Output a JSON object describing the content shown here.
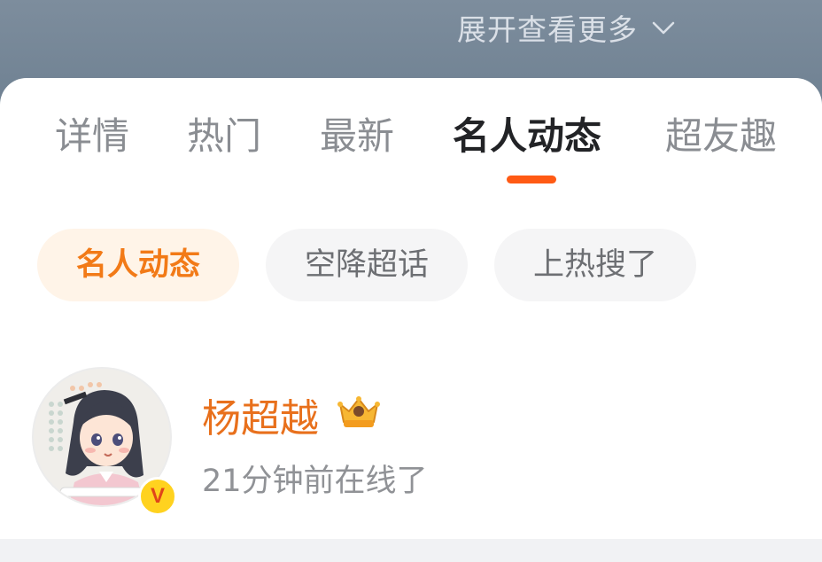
{
  "header": {
    "expand_label": "展开查看更多"
  },
  "tabs": [
    {
      "label": "详情",
      "active": false
    },
    {
      "label": "热门",
      "active": false
    },
    {
      "label": "最新",
      "active": false
    },
    {
      "label": "名人动态",
      "active": true
    },
    {
      "label": "超友趣",
      "active": false
    }
  ],
  "chips": [
    {
      "label": "名人动态",
      "active": true
    },
    {
      "label": "空降超话",
      "active": false
    },
    {
      "label": "上热搜了",
      "active": false
    }
  ],
  "user": {
    "name": "杨超越",
    "status": "21分钟前在线了",
    "verified_mark": "V"
  },
  "colors": {
    "accent": "#ff5a14",
    "name": "#e8701c",
    "chip_active_bg": "#fff4e8",
    "chip_active_text": "#f27a17",
    "header_bg": "#7d8d9d"
  },
  "icons": {
    "expand": "chevron-down-icon",
    "vip": "crown-icon",
    "verified": "verified-badge-icon"
  }
}
